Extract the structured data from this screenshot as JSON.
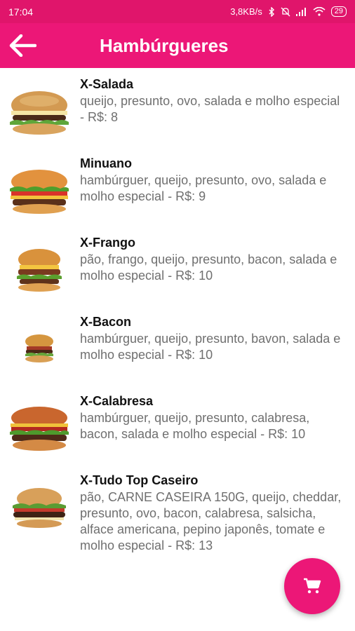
{
  "status_bar": {
    "time": "17:04",
    "speed": "3,8KB/s",
    "battery": "29",
    "icons": [
      "bluetooth-icon",
      "mute-icon",
      "signal-icon",
      "wifi-icon",
      "battery-icon"
    ]
  },
  "app_bar": {
    "title": "Hambúrgueres",
    "back_icon": "arrow-back-icon"
  },
  "items": [
    {
      "name": "X-Salada",
      "desc": "queijo, presunto, ovo, salada e molho especial - R$: 8"
    },
    {
      "name": "Minuano",
      "desc": "hambúrguer, queijo, presunto, ovo, salada e molho especial - R$: 9"
    },
    {
      "name": "X-Frango",
      "desc": "pão, frango, queijo, presunto, bacon, salada e molho especial - R$: 10"
    },
    {
      "name": "X-Bacon",
      "desc": "hambúrguer, queijo, presunto, bavon, salada e molho especial - R$: 10"
    },
    {
      "name": "X-Calabresa",
      "desc": "hambúrguer, queijo, presunto, calabresa, bacon, salada e molho especial - R$: 10"
    },
    {
      "name": "X-Tudo Top Caseiro",
      "desc": "pão, CARNE CASEIRA 150G, queijo, cheddar, presunto, ovo, bacon, calabresa, salsicha, alface americana, pepino japonês, tomate e molho especial - R$: 13"
    }
  ],
  "fab": {
    "icon": "cart-icon"
  },
  "colors": {
    "primary": "#ec1777",
    "status": "#e0156b"
  }
}
